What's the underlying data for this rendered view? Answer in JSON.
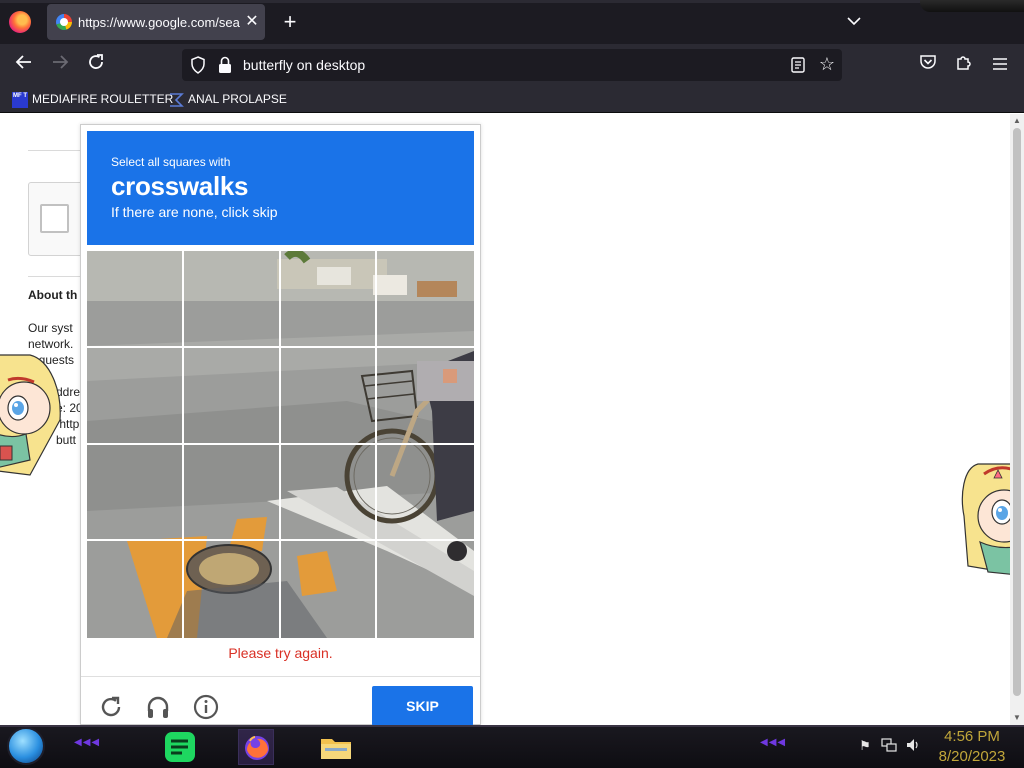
{
  "browser": {
    "tab": {
      "title": "https://www.google.com/search"
    },
    "url": "butterfly on desktop",
    "bookmarks": [
      {
        "label": "MEDIAFIRE ROULETTER",
        "icon": "MF\nT"
      },
      {
        "label": "ANAL PROLAPSE"
      }
    ]
  },
  "background_page": {
    "about_heading": "About th",
    "body_lines": "Our syst\nnetwork.\nrequests",
    "detail_lines": "ddres\ne: 20\n http\nbutt"
  },
  "captcha": {
    "instruction_line1": "Select all squares with",
    "target": "crosswalks",
    "instruction_line3": "If there are none, click skip",
    "error": "Please try again.",
    "skip_label": "SKIP",
    "grid_size": 4
  },
  "taskbar": {
    "time": "4:56 PM",
    "date": "8/20/2023",
    "accent": "#6f38e0"
  }
}
